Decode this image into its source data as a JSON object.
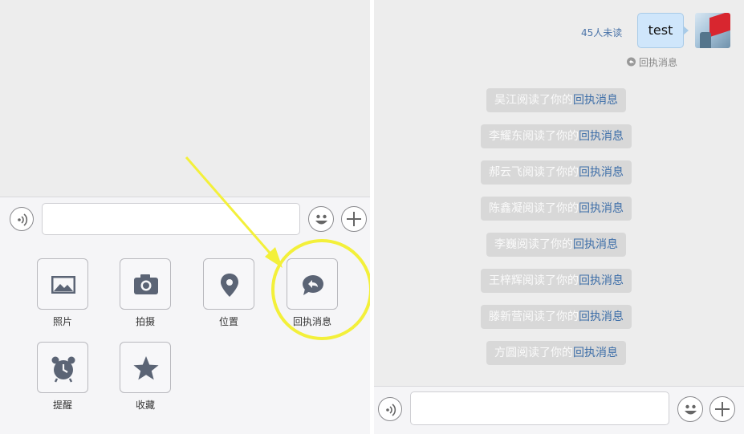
{
  "left": {
    "tools": [
      {
        "label": "照片",
        "icon": "photo-icon"
      },
      {
        "label": "拍摄",
        "icon": "camera-icon"
      },
      {
        "label": "位置",
        "icon": "location-icon"
      },
      {
        "label": "回执消息",
        "icon": "receipt-message-icon"
      },
      {
        "label": "提醒",
        "icon": "alarm-clock-icon"
      },
      {
        "label": "收藏",
        "icon": "star-icon"
      }
    ],
    "annotation": {
      "highlight_color": "#f3f03a",
      "arrow_color": "#f3f03a",
      "target": "回执消息"
    }
  },
  "right": {
    "message": {
      "text": "test",
      "unread": "45人未读",
      "receipt_label": "回执消息"
    },
    "notices": [
      {
        "name": "吴江",
        "suffix": "阅读了你的",
        "link": "回执消息"
      },
      {
        "name": "李耀东",
        "suffix": "阅读了你的",
        "link": "回执消息"
      },
      {
        "name": "郝云飞",
        "suffix": "阅读了你的",
        "link": "回执消息"
      },
      {
        "name": "陈鑫凝",
        "suffix": "阅读了你的",
        "link": "回执消息"
      },
      {
        "name": "李巍",
        "suffix": "阅读了你的",
        "link": "回执消息"
      },
      {
        "name": "王梓辉",
        "suffix": "阅读了你的",
        "link": "回执消息"
      },
      {
        "name": "滕新营",
        "suffix": "阅读了你的",
        "link": "回执消息"
      },
      {
        "name": "方圆",
        "suffix": "阅读了你的",
        "link": "回执消息"
      }
    ]
  },
  "colors": {
    "link": "#3d6ea8",
    "bubble": "#cfe6fb",
    "notice_bg": "#d8d8d8"
  }
}
